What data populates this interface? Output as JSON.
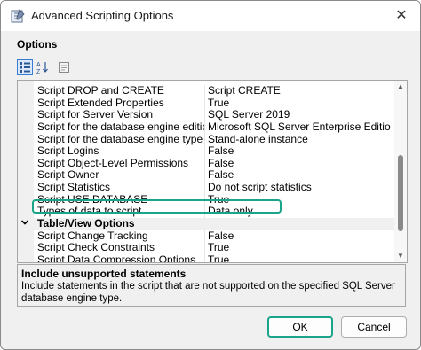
{
  "window": {
    "title": "Advanced Scripting Options",
    "close_glyph": "✕"
  },
  "options_label": "Options",
  "toolbar": {
    "categorized_icon": "categorized-icon",
    "alphabetical_icon": "sort-az-icon",
    "property_pages_icon": "property-pages-icon"
  },
  "grid": {
    "rows_before": [
      {
        "name": "Script DROP and CREATE",
        "value": "Script CREATE"
      },
      {
        "name": "Script Extended Properties",
        "value": "True"
      },
      {
        "name": "Script for Server Version",
        "value": "SQL Server 2019"
      },
      {
        "name": "Script for the database engine edition",
        "value": "Microsoft SQL Server Enterprise Edition"
      },
      {
        "name": "Script for the database engine type",
        "value": "Stand-alone instance"
      },
      {
        "name": "Script Logins",
        "value": "False"
      },
      {
        "name": "Script Object-Level Permissions",
        "value": "False"
      },
      {
        "name": "Script Owner",
        "value": "False"
      },
      {
        "name": "Script Statistics",
        "value": "Do not script statistics"
      },
      {
        "name": "Script USE DATABASE",
        "value": "True"
      },
      {
        "name": "Types of data to script",
        "value": "Data only"
      }
    ],
    "category": {
      "label": "Table/View Options",
      "chevron": "❯"
    },
    "rows_after": [
      {
        "name": "Script Change Tracking",
        "value": "False"
      },
      {
        "name": "Script Check Constraints",
        "value": "True"
      },
      {
        "name": "Script Data Compression Options",
        "value": "True"
      }
    ]
  },
  "description": {
    "title": "Include unsupported statements",
    "text": "Include statements in the script that are not supported on the specified SQL Server database engine type."
  },
  "buttons": {
    "ok": "OK",
    "cancel": "Cancel"
  },
  "colors": {
    "highlight": "#1aa58a",
    "window_bg": "#f0f0f0"
  }
}
